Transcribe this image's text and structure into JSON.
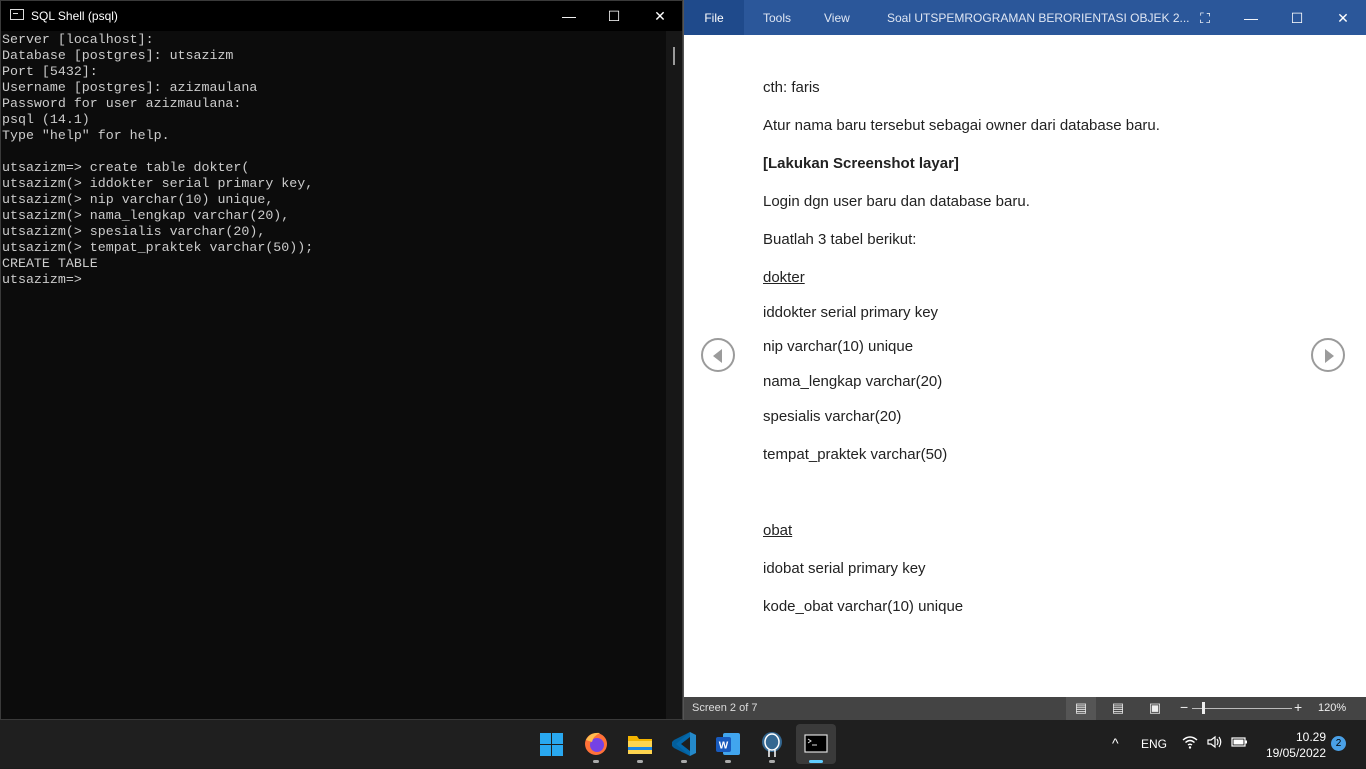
{
  "psql": {
    "title": "SQL Shell (psql)",
    "controls": {
      "minimize": "—",
      "maximize": "☐",
      "close": "✕"
    },
    "lines": [
      "Server [localhost]:",
      "Database [postgres]: utsazizm",
      "Port [5432]:",
      "Username [postgres]: azizmaulana",
      "Password for user azizmaulana:",
      "psql (14.1)",
      "Type \"help\" for help.",
      "",
      "utsazizm=> create table dokter(",
      "utsazizm(> iddokter serial primary key,",
      "utsazizm(> nip varchar(10) unique,",
      "utsazizm(> nama_lengkap varchar(20),",
      "utsazizm(> spesialis varchar(20),",
      "utsazizm(> tempat_praktek varchar(50));",
      "CREATE TABLE",
      "utsazizm=>"
    ]
  },
  "word": {
    "tabs": {
      "file": "File",
      "tools": "Tools",
      "view": "View"
    },
    "doc_title": "Soal UTSPEMROGRAMAN BERORIENTASI OBJEK 2...",
    "controls": {
      "fit": "⛶",
      "minimize": "—",
      "maximize": "☐",
      "close": "✕"
    },
    "content": [
      "cth: faris",
      "Atur nama baru tersebut sebagai owner dari database baru.",
      "[Lakukan Screenshot layar]",
      "Login dgn user baru dan database baru.",
      "Buatlah 3 tabel berikut:",
      "dokter",
      "iddokter serial primary key",
      "nip varchar(10) unique",
      "nama_lengkap varchar(20)",
      "spesialis varchar(20)",
      "tempat_praktek varchar(50)",
      "obat",
      "idobat serial primary key",
      "kode_obat varchar(10) unique"
    ],
    "status": {
      "screen": "Screen 2 of 7",
      "zoom": "120%",
      "zoom_minus": "−",
      "zoom_plus": "+",
      "zoom_slider_fraction": 0.12
    }
  },
  "taskbar": {
    "apps": [
      "start-button",
      "firefox-icon",
      "file-explorer-icon",
      "vscode-icon",
      "word-icon",
      "pgadmin-icon",
      "terminal-icon"
    ],
    "active_app": "terminal-icon",
    "tray": {
      "chevron": "^",
      "language": "ENG",
      "time": "10.29",
      "date": "19/05/2022",
      "notifications": "2"
    }
  }
}
